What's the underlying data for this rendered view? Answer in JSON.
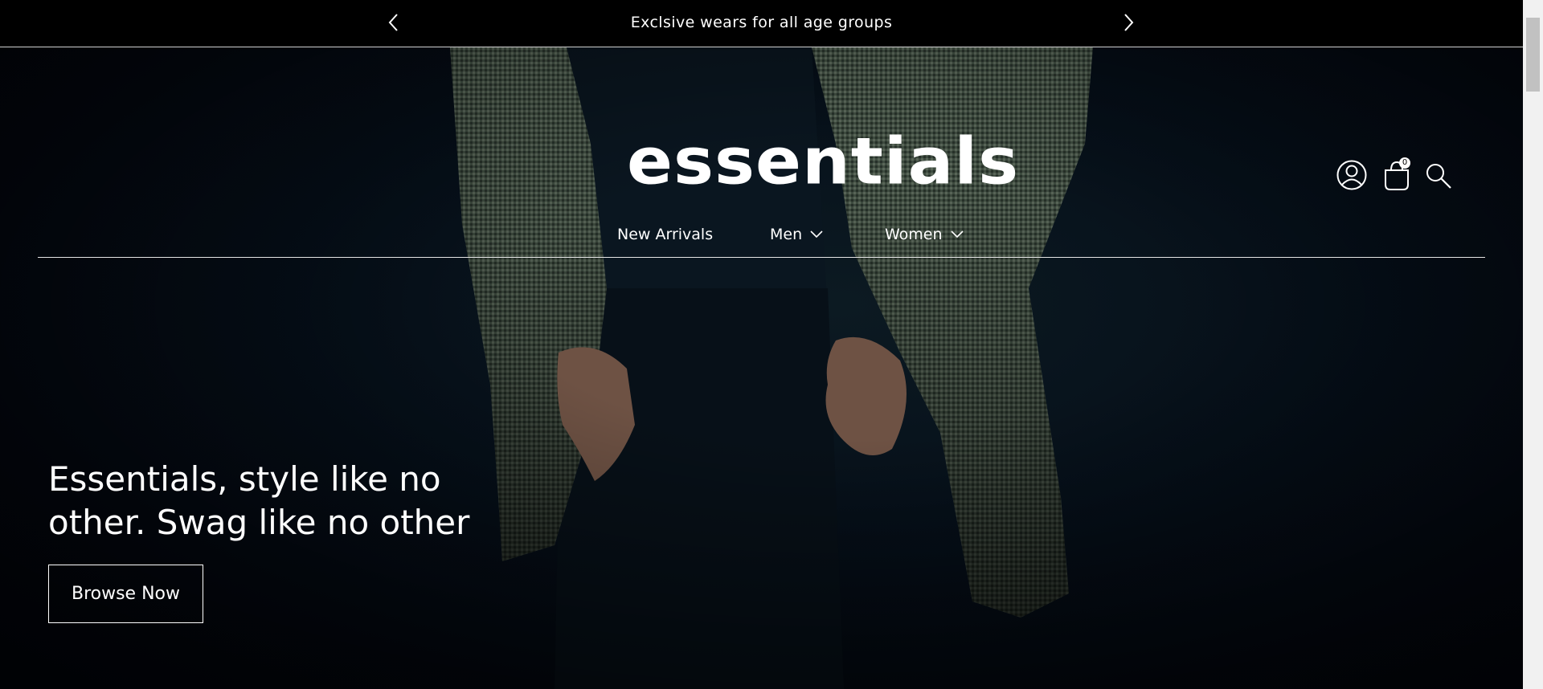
{
  "announcement": {
    "text": "Exclsive wears for all age groups",
    "prev_icon": "chevron-left-icon",
    "next_icon": "chevron-right-icon"
  },
  "header": {
    "logo": "essentials",
    "nav": [
      {
        "label": "New Arrivals",
        "has_dropdown": false
      },
      {
        "label": "Men",
        "has_dropdown": true
      },
      {
        "label": "Women",
        "has_dropdown": true
      }
    ],
    "icons": {
      "account": "account-icon",
      "cart": "cart-icon",
      "search": "search-icon"
    },
    "cart_count": "0"
  },
  "hero": {
    "title": "Essentials, style like no other. Swag like no other",
    "cta_label": "Browse Now"
  },
  "colors": {
    "announcement_bg": "#000000",
    "hero_bg": "#040c16",
    "text": "#ffffff"
  }
}
